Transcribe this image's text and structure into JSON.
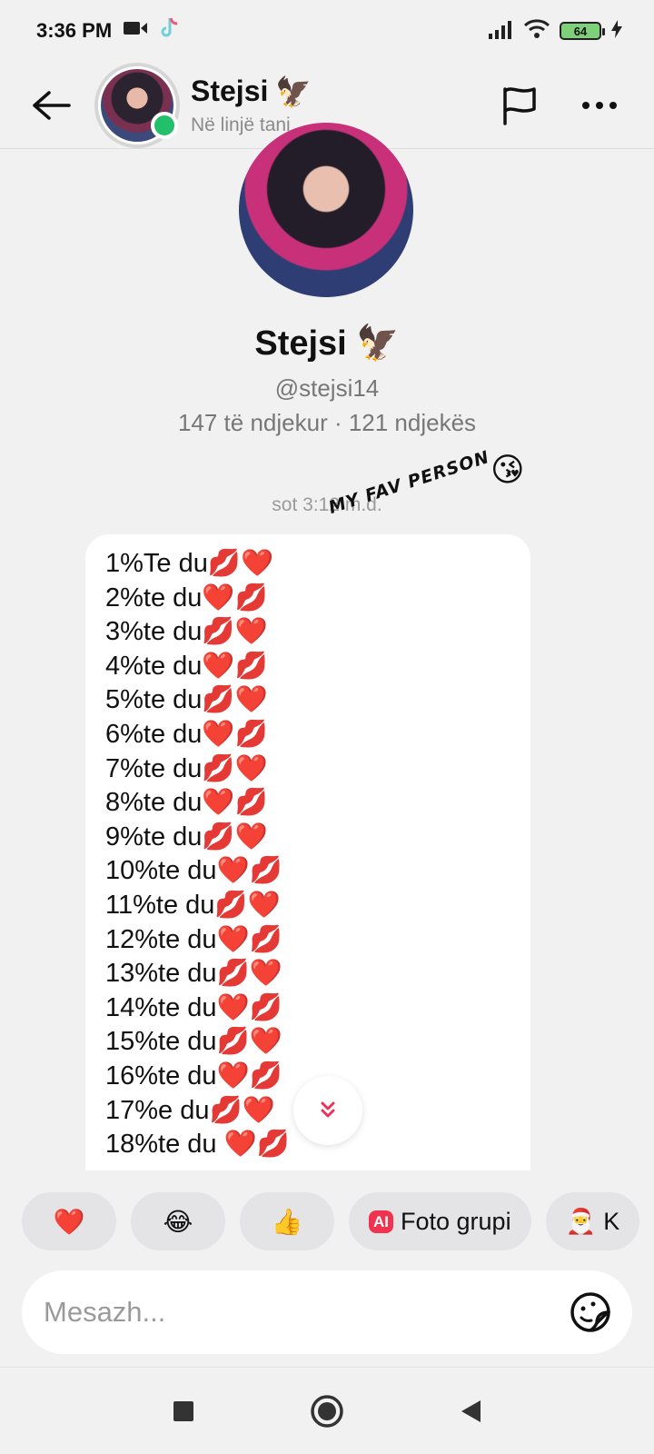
{
  "status_bar": {
    "time": "3:36 PM",
    "battery": "64"
  },
  "header": {
    "name": "Stejsi",
    "name_emoji": "🦅",
    "status": "Në linjë tani"
  },
  "profile": {
    "name": "Stejsi",
    "name_emoji": "🦅",
    "handle": "@stejsi14",
    "stats": "147 të ndjekur · 121 ndjekës"
  },
  "chat": {
    "timestamp": "sot 3:12 m.d.",
    "sticker_text": "MY FAV PERSON",
    "sticker_emoji": "😘",
    "message_lines": [
      "1%Te du💋❤️",
      "2%te du❤️💋",
      "3%te du💋❤️",
      "4%te du❤️💋",
      "5%te du💋❤️",
      "6%te du❤️💋",
      "7%te du💋❤️",
      "8%te du❤️💋",
      "9%te du💋❤️",
      "10%te du❤️💋",
      "11%te du💋❤️",
      "12%te du❤️💋",
      "13%te du💋❤️",
      "14%te du❤️💋",
      "15%te du💋❤️",
      "16%te du❤️💋",
      "17%e du💋❤️",
      "18%te du ❤️💋"
    ]
  },
  "quick_replies": {
    "heart": "❤️",
    "laugh": "😂",
    "thumbs_up": "👍",
    "ai_badge": "AI",
    "ai_label": "Foto grupi",
    "partial_emoji": "🎅",
    "partial_label": "K"
  },
  "composer": {
    "placeholder": "Mesazh..."
  }
}
